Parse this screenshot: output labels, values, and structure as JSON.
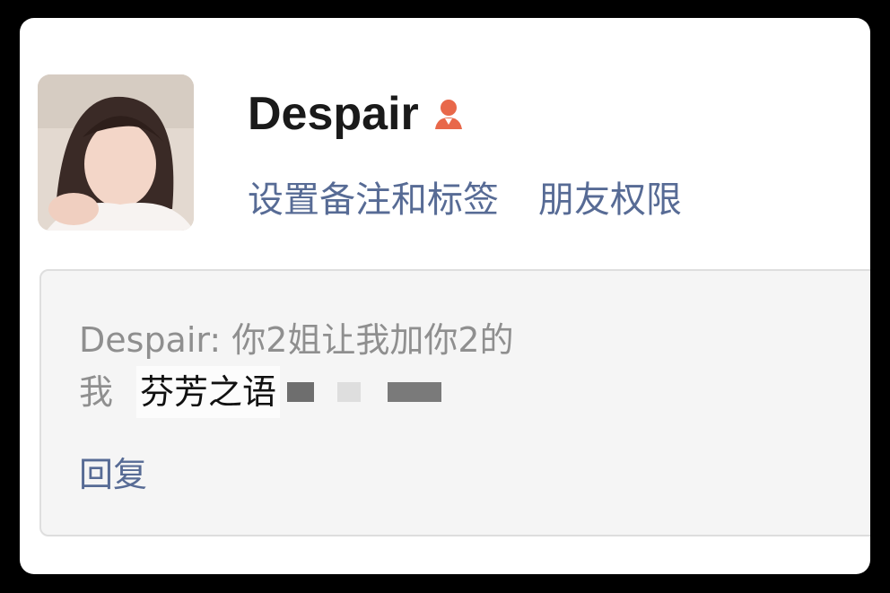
{
  "contact": {
    "name": "Despair",
    "gender_icon": "female-user-icon",
    "gender_icon_color": "#e8684a"
  },
  "actions": {
    "set_remark_label": "设置备注和标签",
    "friend_permission_label": "朋友权限"
  },
  "request": {
    "message_line1": "Despair: 你2姐让我加你2的",
    "message_line2_prefix": "我",
    "message_line2_visible": "芬芳之语",
    "reply_label": "回复"
  },
  "colors": {
    "link": "#576b95",
    "message_text": "#8f8f8f",
    "name_text": "#1a1a1a",
    "box_bg": "#f5f5f5"
  }
}
